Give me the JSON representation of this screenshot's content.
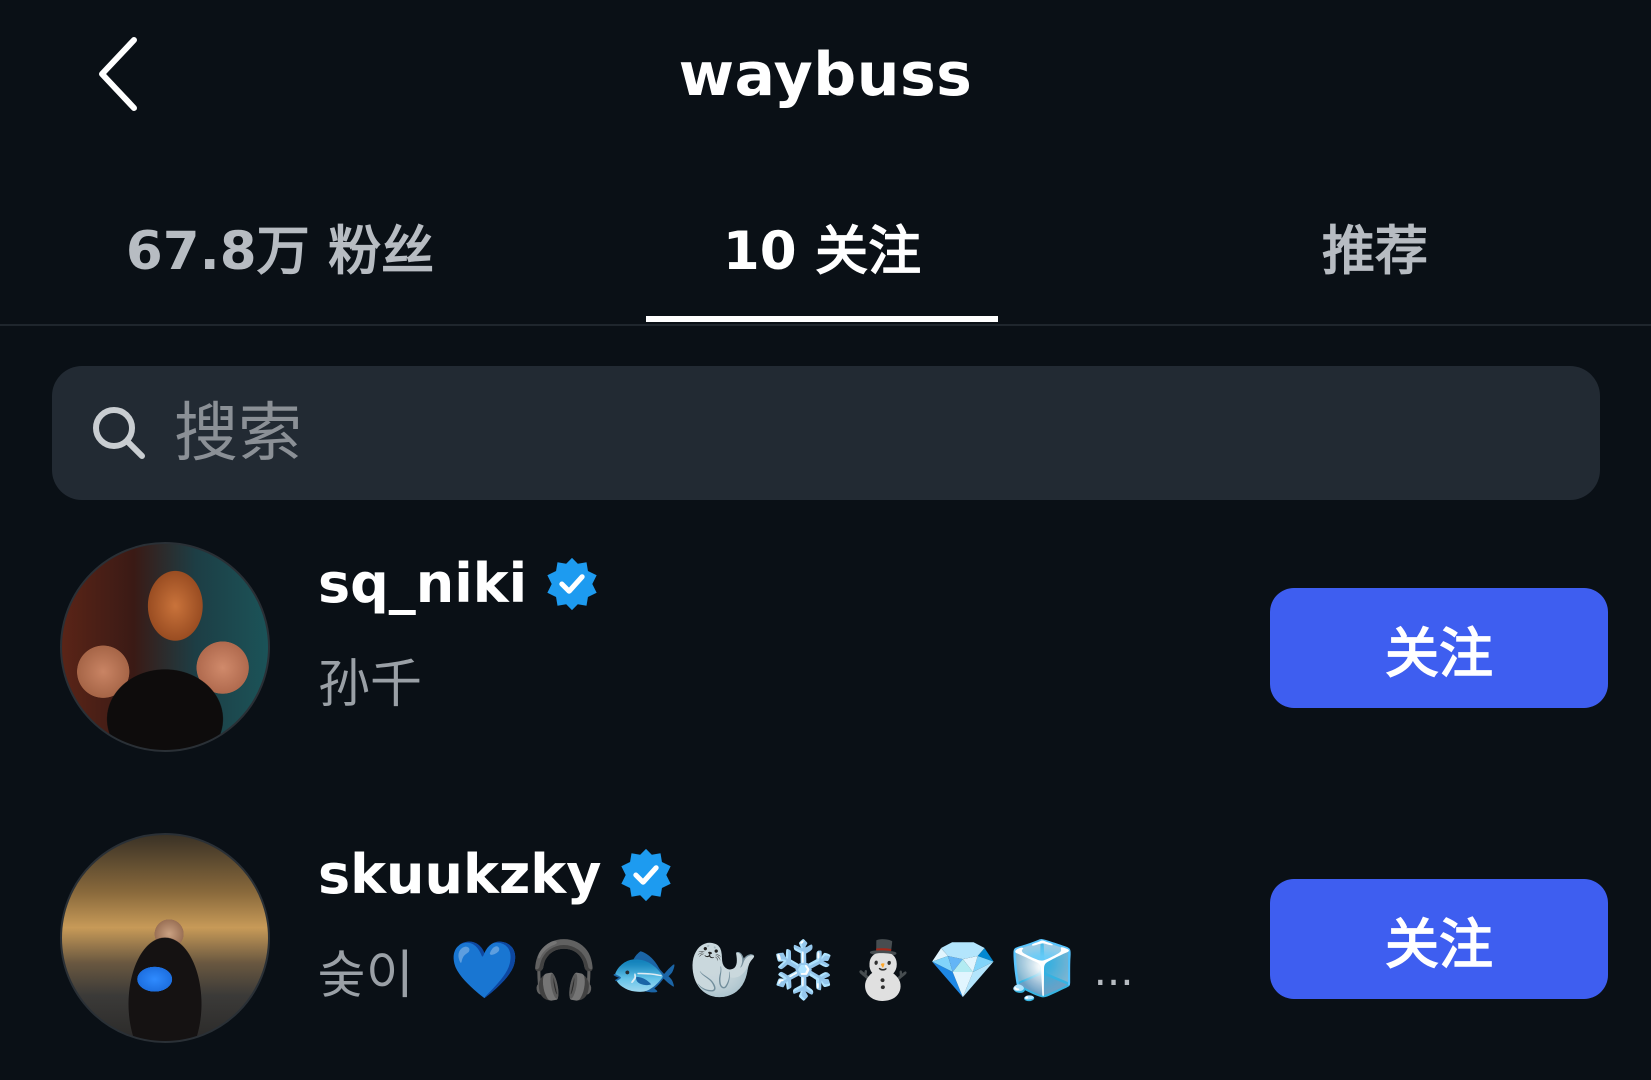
{
  "header": {
    "title": "waybuss",
    "back_icon": "chevron-left-icon"
  },
  "tabs": [
    {
      "label": "67.8万 粉丝",
      "selected": false
    },
    {
      "label": "10 关注",
      "selected": true
    },
    {
      "label": "推荐",
      "selected": false
    }
  ],
  "search": {
    "placeholder": "搜索",
    "value": "",
    "icon": "search-icon"
  },
  "following": [
    {
      "username": "sq_niki",
      "verified": true,
      "display_name": "孙千",
      "emojis": [],
      "button_label": "关注"
    },
    {
      "username": "skuukzky",
      "verified": true,
      "display_name": "숮이",
      "emojis": [
        "💙",
        "🎧",
        "🐟",
        "🦭",
        "❄️",
        "⛄",
        "💎",
        "🧊"
      ],
      "truncation": "...",
      "button_label": "关注"
    }
  ],
  "colors": {
    "background": "#0a1016",
    "accent": "#3e5ef0",
    "verified": "#1d9bf0",
    "search_bg": "#222a33",
    "muted_text": "#9aa0a6"
  }
}
